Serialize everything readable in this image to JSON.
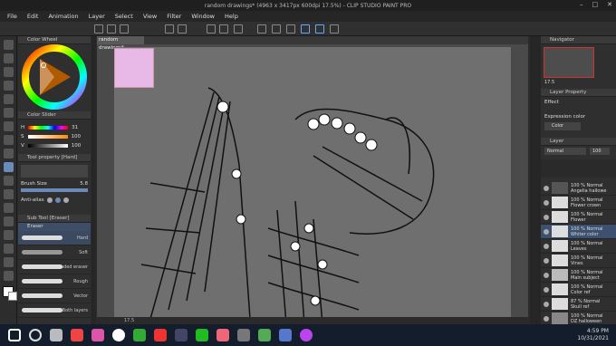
{
  "title": "random drawings* (4963 x 3417px 600dpi 17.5%)  - CLIP STUDIO PAINT PRO",
  "menu": [
    "File",
    "Edit",
    "Animation",
    "Layer",
    "Select",
    "View",
    "Filter",
    "Window",
    "Help"
  ],
  "doc_tab": "random drawings*",
  "panels": {
    "color_wheel": "Color Wheel",
    "color_slider": "Color Slider",
    "slider_values": {
      "h": "31",
      "s": "100",
      "v": "100"
    },
    "tool_property": "Tool property [Hard]",
    "brush_size_label": "Brush Size",
    "brush_size_value": "5.8",
    "anti_alias_label": "Anti-alias",
    "sub_tool": "Sub Tool [Eraser]",
    "eraser_label": "Eraser",
    "brushes": [
      "Hard",
      "Soft",
      "Kneaded eraser",
      "Rough",
      "Vector",
      "Both layers"
    ],
    "navigator": "Navigator",
    "zoom": "17.5",
    "layer_property": "Layer Property",
    "effect_label": "Effect",
    "expression_color_label": "Expression color",
    "color_option": "Color",
    "layer_panel": "Layer",
    "blend_mode": "Normal",
    "opacity": "100"
  },
  "layers": [
    {
      "pct": "100 %",
      "mode": "Normal",
      "name": "Angelia hallowe"
    },
    {
      "pct": "100 %",
      "mode": "Normal",
      "name": "Flower crown"
    },
    {
      "pct": "100 %",
      "mode": "Normal",
      "name": "Flower"
    },
    {
      "pct": "100 %",
      "mode": "Normal",
      "name": "Whiter color"
    },
    {
      "pct": "100 %",
      "mode": "Normal",
      "name": "Leaves"
    },
    {
      "pct": "100 %",
      "mode": "Normal",
      "name": "Vines"
    },
    {
      "pct": "100 %",
      "mode": "Normal",
      "name": "Main subject"
    },
    {
      "pct": "100 %",
      "mode": "Normal",
      "name": "Color ref"
    },
    {
      "pct": "87 %",
      "mode": "Normal",
      "name": "Skull ref"
    },
    {
      "pct": "100 %",
      "mode": "Normal",
      "name": "DZ halloween"
    }
  ],
  "status_zoom": "17.5",
  "clock": {
    "time": "4:59 PM",
    "date": "10/31/2021"
  }
}
